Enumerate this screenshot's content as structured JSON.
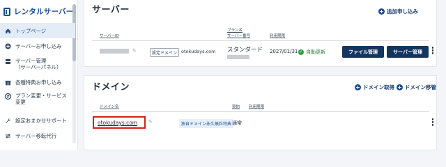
{
  "sidebar": {
    "brand": "レンタルサーバー",
    "items": [
      {
        "label": "トップページ",
        "icon": "home-icon",
        "active": true
      },
      {
        "label": "サーバーお申し込み",
        "icon": "plus-circle-icon"
      },
      {
        "label": "サーバー管理",
        "sub": "（サーバーパネル）",
        "icon": "server-icon"
      },
      {
        "label": "各種特典お申し込み",
        "icon": "gift-icon"
      },
      {
        "label": "プラン変更・サービス",
        "sub": "変更",
        "icon": "swap-icon"
      },
      {
        "label": "設定おまかせサポート",
        "icon": "wrench-icon"
      },
      {
        "label": "サーバー移転代行",
        "icon": "transfer-icon"
      }
    ]
  },
  "server": {
    "title": "サーバー",
    "add_label": "追加申し込み",
    "col_server_id": "サーバーID",
    "col_plan": "プラン名",
    "col_server_no": "サーバー番号",
    "col_expiry": "利用期限",
    "default_domain_tag": "設定ドメイン",
    "default_domain": "otokudays.com",
    "plan": "スタンダード",
    "expiry": "2027/01/31",
    "status": "自動更新",
    "file_btn": "ファイル管理",
    "server_btn": "サーバー管理"
  },
  "domain": {
    "title": "ドメイン",
    "acquire_label": "ドメイン取得",
    "transfer_label": "ドメイン移管",
    "col_domain": "ドメイン名",
    "col_contract": "契約",
    "col_expiry": "利用期限",
    "domain_name": "otokudays.com",
    "badge": "独自ドメイン永久無料特典",
    "contract": "通常"
  }
}
